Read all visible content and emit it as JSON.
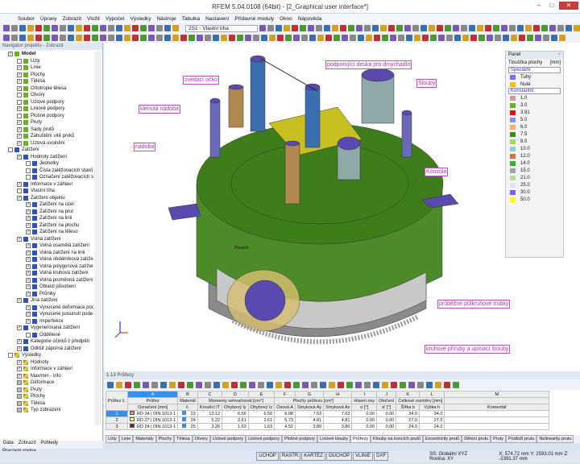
{
  "app": {
    "title": "RFEM 5.04.0108 (64bit) - [2_Graphical user interface*]"
  },
  "menu": [
    "Soubor",
    "Úpravy",
    "Zobrazit",
    "Vložit",
    "Výpočet",
    "Výsledky",
    "Nástroje",
    "Tabulka",
    "Nastavení",
    "Přídavné moduly",
    "Okno",
    "Nápověda"
  ],
  "toolbar": {
    "load_case": "2S1 - Vlastní tíha"
  },
  "navigator": {
    "title": "Navigátor projektu - Zobrazit",
    "items": [
      [
        "Model",
        0,
        "c",
        "m"
      ],
      [
        "Uzly",
        1,
        "u",
        "m"
      ],
      [
        "Linie",
        1,
        "c",
        "m"
      ],
      [
        "Plochy",
        1,
        "c",
        "m"
      ],
      [
        "Tělesa",
        1,
        "c",
        "m"
      ],
      [
        "Ortotropie tělesa",
        1,
        "c",
        "m"
      ],
      [
        "Otvory",
        1,
        "u",
        "m"
      ],
      [
        "Uzlové podpory",
        1,
        "u",
        "m"
      ],
      [
        "Liniové podpory",
        1,
        "c",
        "m"
      ],
      [
        "Plošné podpory",
        1,
        "u",
        "m"
      ],
      [
        "Pruty",
        1,
        "c",
        "m"
      ],
      [
        "Sady prutů",
        1,
        "c",
        "m"
      ],
      [
        "Zahuštění sítě prvků",
        1,
        "c",
        "m"
      ],
      [
        "Uzlová uvolnění",
        1,
        "c",
        "m"
      ],
      [
        "Zatížení",
        0,
        "u",
        "l"
      ],
      [
        "Hodnoty zatížení",
        1,
        "c",
        "l"
      ],
      [
        "Jednotky",
        2,
        "u",
        "l"
      ],
      [
        "Čísla zatěžovacích stavů",
        2,
        "u",
        "l"
      ],
      [
        "Označení zatěžovacích st",
        2,
        "u",
        "l"
      ],
      [
        "Informace v záhlaví",
        1,
        "c",
        "l"
      ],
      [
        "Vlastní tíha",
        1,
        "u",
        "l"
      ],
      [
        "Zatížení objektu",
        1,
        "c",
        "l"
      ],
      [
        "Zatížení na uzel",
        2,
        "c",
        "l"
      ],
      [
        "Zatížení na prut",
        2,
        "c",
        "l"
      ],
      [
        "Zatížení na linii",
        2,
        "c",
        "l"
      ],
      [
        "Zatížení na plochu",
        2,
        "c",
        "l"
      ],
      [
        "Zatížení na těleso",
        2,
        "c",
        "l"
      ],
      [
        "Volná zatížení",
        1,
        "c",
        "l"
      ],
      [
        "Volná osamělá zatížení",
        2,
        "c",
        "l"
      ],
      [
        "Volná zatížení na linii",
        2,
        "c",
        "l"
      ],
      [
        "Volná obdélníková zatížen",
        2,
        "c",
        "l"
      ],
      [
        "Volná polygonová zatížen",
        2,
        "c",
        "l"
      ],
      [
        "Volná kruhová zatížení",
        2,
        "c",
        "l"
      ],
      [
        "Volná proměnná zatížení",
        2,
        "c",
        "l"
      ],
      [
        "Oblasti působení",
        2,
        "c",
        "l"
      ],
      [
        "Průniky",
        2,
        "c",
        "l"
      ],
      [
        "Jiná zatížení",
        1,
        "c",
        "l"
      ],
      [
        "Vynucené deformace poc",
        2,
        "c",
        "l"
      ],
      [
        "Vynucené posunutí pode",
        2,
        "c",
        "l"
      ],
      [
        "Imperfekce",
        2,
        "c",
        "l"
      ],
      [
        "Vygenerovaná zatížení",
        1,
        "c",
        "l"
      ],
      [
        "Oddělené",
        2,
        "u",
        "l"
      ],
      [
        "Kategorie účinků z předpětí",
        1,
        "c",
        "l"
      ],
      [
        "Odlišit záporná zatížení",
        1,
        "c",
        "l"
      ],
      [
        "Výsledky",
        0,
        "u",
        "r"
      ],
      [
        "Hodnoty",
        1,
        "c",
        "r"
      ],
      [
        "Informace v záhlaví",
        1,
        "c",
        "r"
      ],
      [
        "Max/min - info",
        1,
        "c",
        "r"
      ],
      [
        "Deformace",
        1,
        "p",
        "r"
      ],
      [
        "Pruty",
        1,
        "p",
        "r"
      ],
      [
        "Plochy",
        1,
        "p",
        "r"
      ],
      [
        "Tělesa",
        1,
        "p",
        "r"
      ],
      [
        "Typ zobrazení",
        1,
        "p",
        "r"
      ]
    ],
    "tabs": [
      "Data",
      "Zobrazit",
      "Pohledy"
    ],
    "status": "Pracovní rovina"
  },
  "panel": {
    "title": "Panel",
    "heading": "Tloušťka plochy",
    "unit": "[mm]",
    "special_label": "Speciální",
    "constant_label": "Konstantní",
    "special": [
      [
        "Tuhý",
        "#8a6af0"
      ],
      [
        "Nula",
        "#f2c000"
      ]
    ],
    "constant": [
      [
        "1.0",
        "#d49a9a"
      ],
      [
        "3.0",
        "#6ab020"
      ],
      [
        "3.91",
        "#f01010"
      ],
      [
        "5.0",
        "#8090ff"
      ],
      [
        "6.0",
        "#f0b070"
      ],
      [
        "7.5",
        "#3a9010"
      ],
      [
        "8.0",
        "#a0e040"
      ],
      [
        "10.0",
        "#90d0d0"
      ],
      [
        "12.0",
        "#e07030"
      ],
      [
        "14.0",
        "#30b030"
      ],
      [
        "15.0",
        "#a0a0a0"
      ],
      [
        "21.0",
        "#b0e090"
      ],
      [
        "25.0",
        "#e0e0ff"
      ],
      [
        "30.0",
        "#8060f0"
      ],
      [
        "50.0",
        "#ffff00"
      ]
    ]
  },
  "labels": {
    "l1": "podporující deska pro dmychadlo",
    "l2": "zvedací očko",
    "l3": "Sloupy",
    "l4": "klenutá nádoba",
    "l5": "nádoba",
    "l6": "Konzola",
    "l7": "průběžné půlkruhové trubky",
    "l8": "kruhové příruby a upínací šrouby",
    "l9": "Plassch"
  },
  "table": {
    "title": "1.13 Průřezy",
    "cols": [
      "A",
      "B",
      "C",
      "D",
      "E",
      "F",
      "G",
      "H",
      "I",
      "J",
      "K",
      "L",
      "M"
    ],
    "h1": [
      "Průřez č.",
      "Průřez",
      "Materiál",
      "Momenty setrvačnosti [cm⁴]",
      "Plochy průřezu [cm²]",
      "Hlavní osy",
      "Otočení",
      "Celkové rozměry [mm]",
      ""
    ],
    "h2": [
      "Označení [mm]",
      "č.",
      "Kroutící IT",
      "Ohybový Iy",
      "Ohybový Iz",
      "Osová A",
      "Smyková Ay",
      "Smyková Az",
      "α [°]",
      "α' [°]",
      "Šířka b",
      "Výška h",
      "Komentář"
    ],
    "rows": [
      [
        "1",
        "#f08080",
        "RD 34 | DIN 1013-1",
        "23",
        "13.12",
        "6.56",
        "6.56",
        "9.08",
        "7.63",
        "7.63",
        "0.00",
        "0.00",
        "34.0",
        "34.0",
        ""
      ],
      [
        "2",
        "#ffff60",
        "RD 27 | DIN 1013-1",
        "24",
        "5.22",
        "2.61",
        "2.61",
        "5.73",
        "4.81",
        "4.81",
        "0.00",
        "0.00",
        "27.0",
        "27.0",
        ""
      ],
      [
        "3",
        "#802020",
        "RD 24 | DIN 1013-1",
        "25",
        "3.26",
        "1.63",
        "1.63",
        "4.52",
        "3.80",
        "3.80",
        "0.00",
        "0.00",
        "24.0",
        "24.0",
        ""
      ]
    ]
  },
  "tabs": [
    "Uzly",
    "Linie",
    "Materiály",
    "Plochy",
    "Tělesa",
    "Otvory",
    "Uzlové podpory",
    "Liniové podpory",
    "Plošné podpory",
    "Liniové klouby",
    "Průřezy",
    "Klouby na koncích prutů",
    "Excentricity prutů",
    "Dělení prutu",
    "Pruty",
    "Podloží prutu",
    "Nelinearity prutu"
  ],
  "active_tab": "Průřezy",
  "statusbar": {
    "buttons": [
      "UCHOP",
      "RASTR",
      "KARTÉZ",
      "OUCHOP",
      "VLINIE",
      "DXF"
    ],
    "cs": "SS: Globální XYZ  Rovina: XY",
    "coords": "X: 574.72 mm  Y: 2593.01 mm Z: -2391.37 mm"
  }
}
